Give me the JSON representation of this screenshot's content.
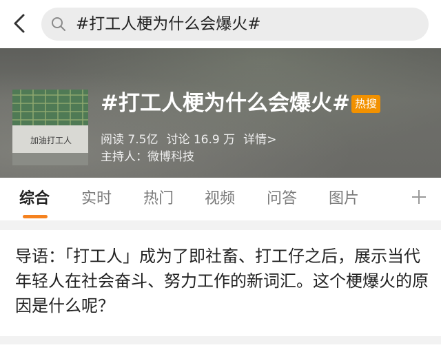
{
  "search": {
    "query": "#打工人梗为什么会爆火#"
  },
  "topic": {
    "title": "#打工人梗为什么会爆火#",
    "badge": "热搜",
    "reads": "阅读 7.5亿",
    "discussions": "讨论 16.9 万",
    "details": "详情>",
    "host": "主持人：微博科技",
    "thumbnail_text": "加油打工人"
  },
  "tabs": [
    {
      "label": "综合"
    },
    {
      "label": "实时"
    },
    {
      "label": "热门"
    },
    {
      "label": "视频"
    },
    {
      "label": "问答"
    },
    {
      "label": "图片"
    }
  ],
  "intro": {
    "text": "导语：「打工人」成为了即社畜、打工仔之后，展示当代年轻人在社会奋斗、努力工作的新词汇。这个梗爆火的原因是什么呢？"
  },
  "colors": {
    "accent": "#f5821f",
    "badge": "#f29100",
    "search_bg": "#ececec",
    "banner_bg": "#6a6a66"
  },
  "icons": {
    "back": "chevron-left-icon",
    "search": "search-icon",
    "add_tab": "plus-icon"
  }
}
